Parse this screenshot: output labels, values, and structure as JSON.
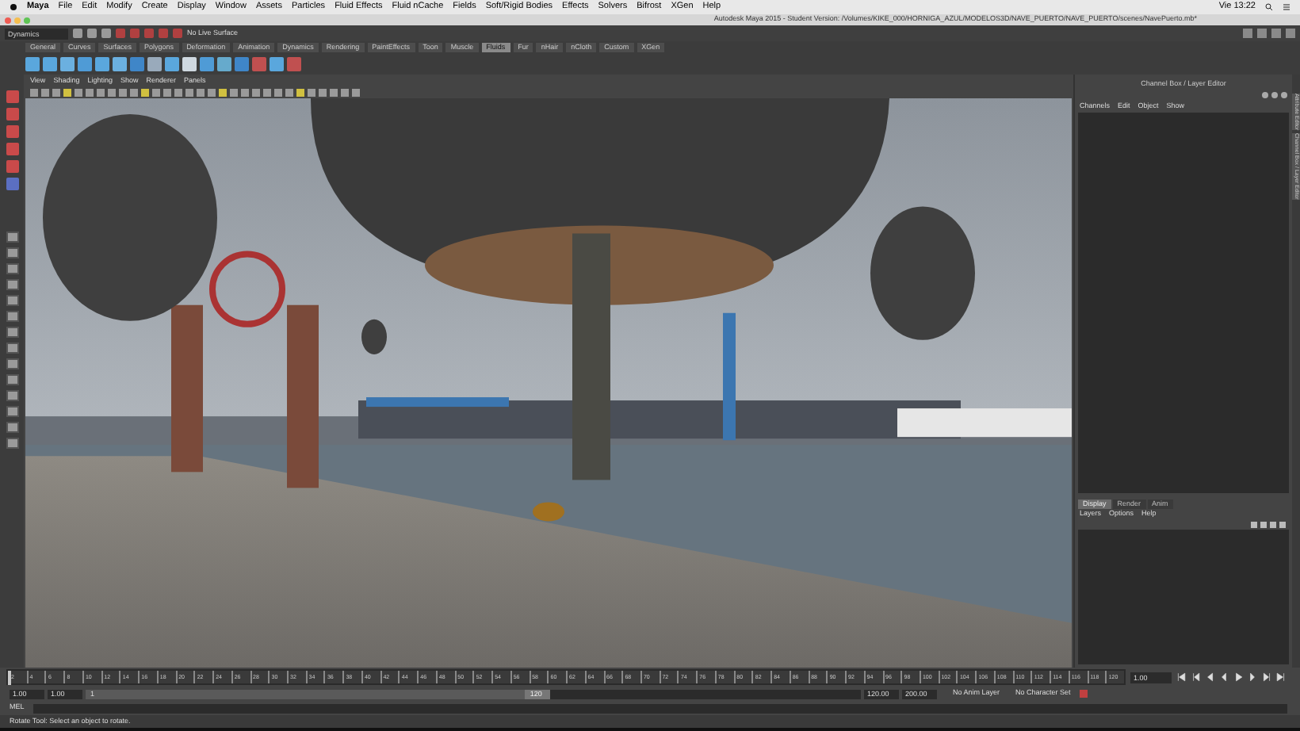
{
  "menu_bar": {
    "app": "Maya",
    "items": [
      "File",
      "Edit",
      "Modify",
      "Create",
      "Display",
      "Window",
      "Assets",
      "Particles",
      "Fluid Effects",
      "Fluid nCache",
      "Fields",
      "Soft/Rigid Bodies",
      "Effects",
      "Solvers",
      "Bifrost",
      "XGen",
      "Help"
    ],
    "clock": "Vie 13:22"
  },
  "window": {
    "title": "Autodesk Maya 2015 - Student Version: /Volumes/KIKE_000/HORNIGA_AZUL/MODELOS3D/NAVE_PUERTO/NAVE_PUERTO/scenes/NavePuerto.mb*"
  },
  "status_line": {
    "mode": "Dynamics",
    "live_surface": "No Live Surface"
  },
  "shelf_tabs": [
    {
      "label": "General",
      "selected": false
    },
    {
      "label": "Curves",
      "selected": false
    },
    {
      "label": "Surfaces",
      "selected": false
    },
    {
      "label": "Polygons",
      "selected": false
    },
    {
      "label": "Deformation",
      "selected": false
    },
    {
      "label": "Animation",
      "selected": false
    },
    {
      "label": "Dynamics",
      "selected": false
    },
    {
      "label": "Rendering",
      "selected": false
    },
    {
      "label": "PaintEffects",
      "selected": false
    },
    {
      "label": "Toon",
      "selected": false
    },
    {
      "label": "Muscle",
      "selected": false
    },
    {
      "label": "Fluids",
      "selected": true
    },
    {
      "label": "Fur",
      "selected": false
    },
    {
      "label": "nHair",
      "selected": false
    },
    {
      "label": "nCloth",
      "selected": false
    },
    {
      "label": "Custom",
      "selected": false
    },
    {
      "label": "XGen",
      "selected": false
    }
  ],
  "panel_menu": [
    "View",
    "Shading",
    "Lighting",
    "Show",
    "Renderer",
    "Panels"
  ],
  "channel_box": {
    "title": "Channel Box / Layer Editor",
    "menu": [
      "Channels",
      "Edit",
      "Object",
      "Show"
    ]
  },
  "layer_editor": {
    "tabs": [
      {
        "label": "Display",
        "selected": true
      },
      {
        "label": "Render",
        "selected": false
      },
      {
        "label": "Anim",
        "selected": false
      }
    ],
    "menu": [
      "Layers",
      "Options",
      "Help"
    ]
  },
  "side_tabs": [
    "Attribute Editor",
    "Channel Box / Layer Editor"
  ],
  "time_slider": {
    "ticks": [
      "2",
      "4",
      "6",
      "8",
      "10",
      "12",
      "14",
      "16",
      "18",
      "20",
      "22",
      "24",
      "26",
      "28",
      "30",
      "32",
      "34",
      "36",
      "38",
      "40",
      "42",
      "44",
      "46",
      "48",
      "50",
      "52",
      "54",
      "56",
      "58",
      "60",
      "62",
      "64",
      "66",
      "68",
      "70",
      "72",
      "74",
      "76",
      "78",
      "80",
      "82",
      "84",
      "86",
      "88",
      "90",
      "92",
      "94",
      "96",
      "98",
      "100",
      "102",
      "104",
      "106",
      "108",
      "110",
      "112",
      "114",
      "116",
      "118",
      "120"
    ],
    "current_frame": "1.00",
    "level": 0
  },
  "range_slider": {
    "start": "1.00",
    "playback_start": "1.00",
    "range_start": "1",
    "range_end": "120",
    "level": 0.6,
    "playback_end": "120.00",
    "end": "200.00",
    "anim_layer": "No Anim Layer",
    "character_set": "No Character Set"
  },
  "command_line": {
    "language": "MEL"
  },
  "help_line": "Rotate Tool: Select an object to rotate."
}
